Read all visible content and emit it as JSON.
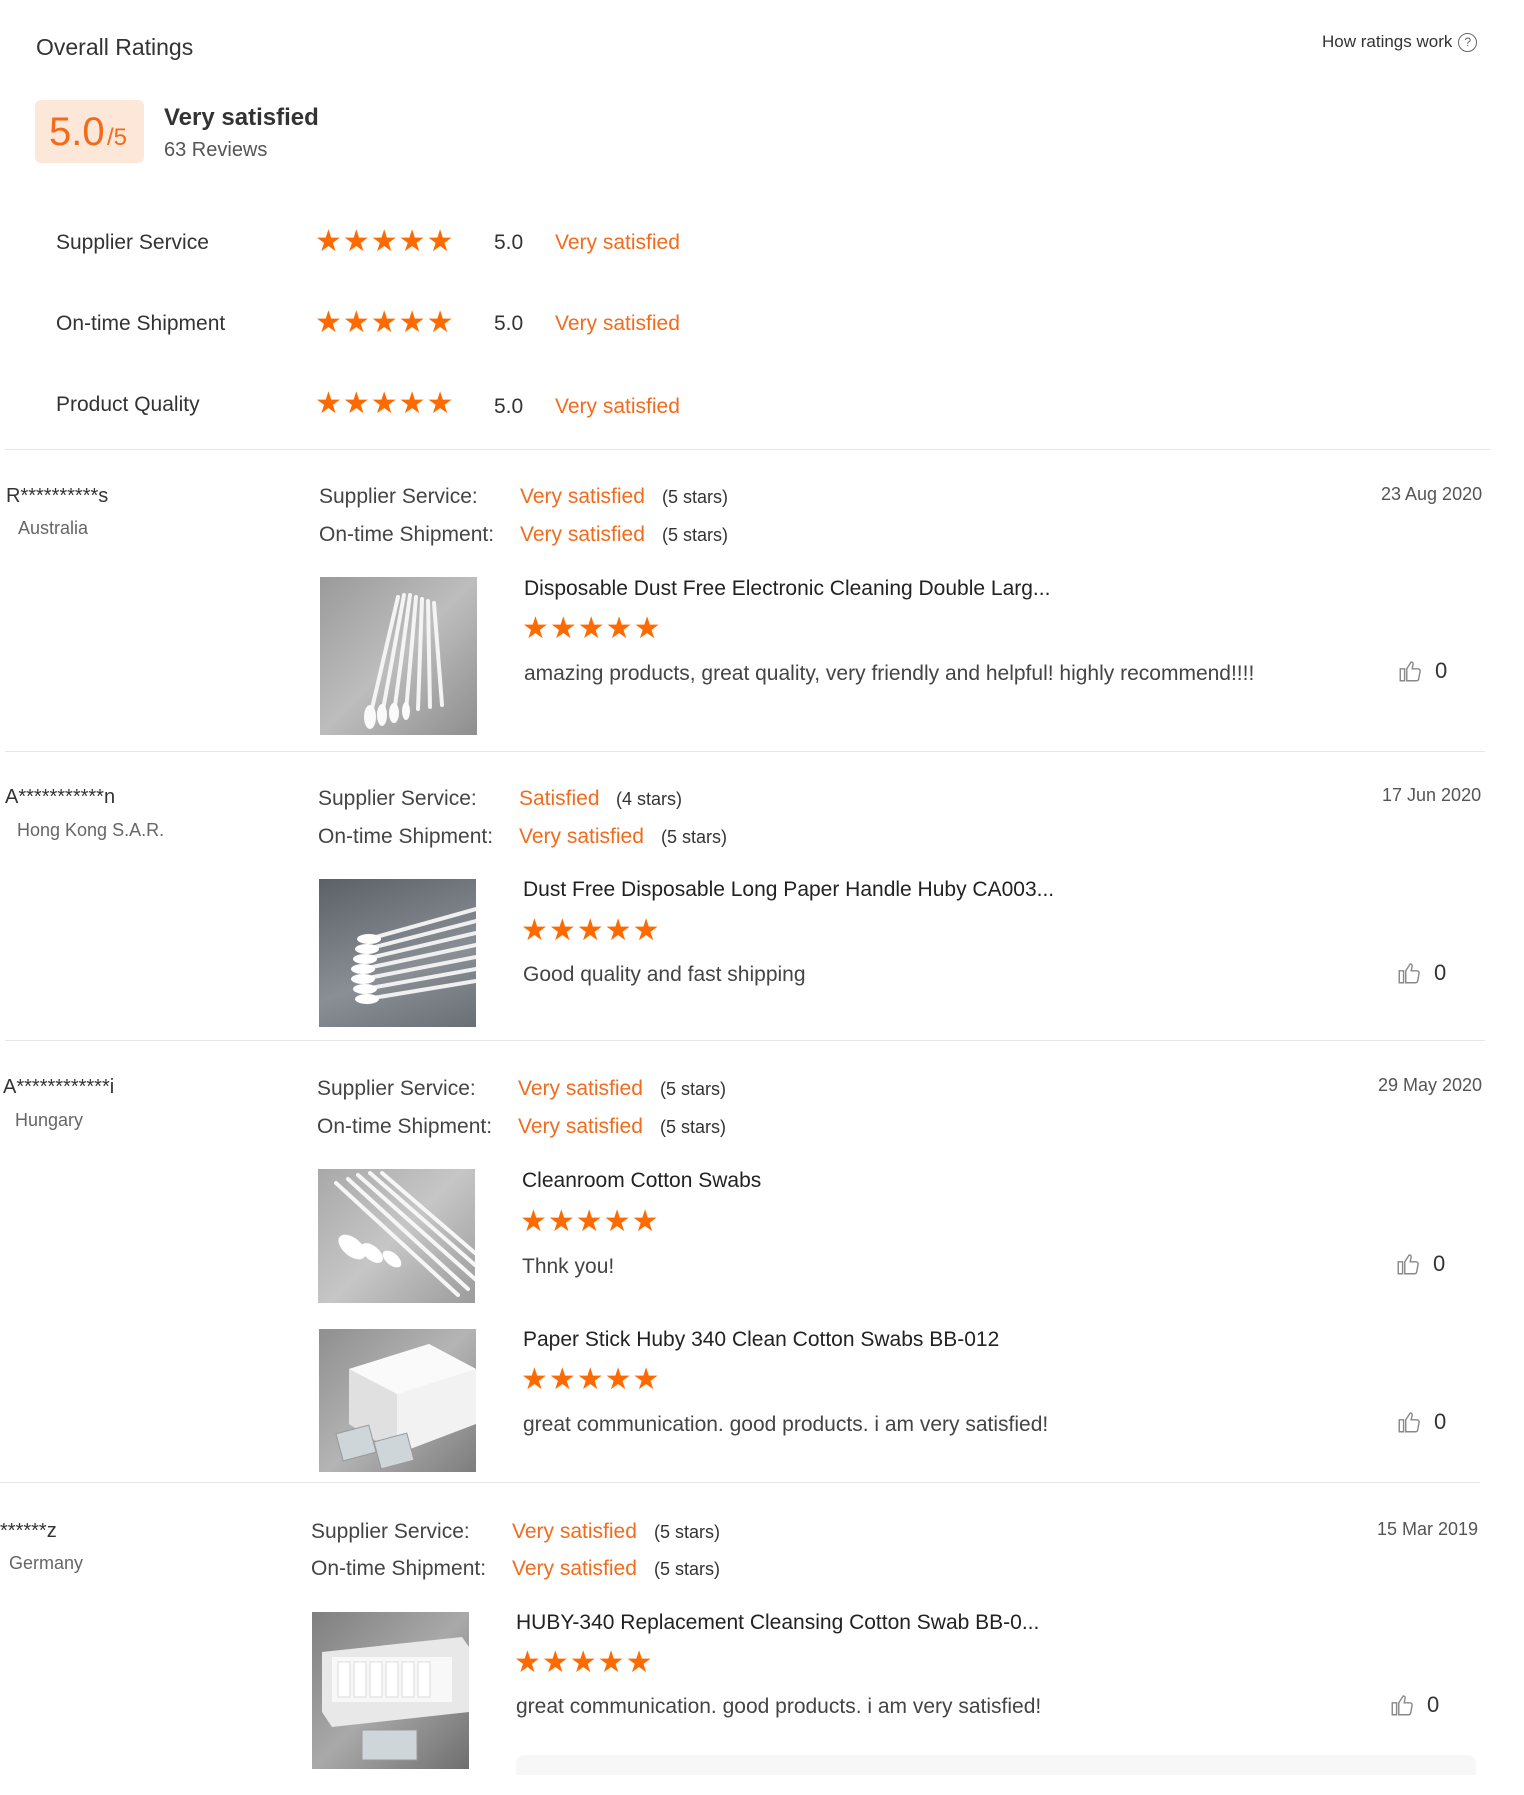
{
  "overall": {
    "title": "Overall Ratings",
    "how_link": "How ratings work",
    "help_icon": "?",
    "score": "5.0",
    "score_max": "/5",
    "verdict": "Very satisfied",
    "reviews_count": "63 Reviews",
    "breakdown": [
      {
        "label": "Supplier Service",
        "stars": 5,
        "value": "5.0",
        "verdict": "Very satisfied"
      },
      {
        "label": "On-time Shipment",
        "stars": 5,
        "value": "5.0",
        "verdict": "Very satisfied"
      },
      {
        "label": "Product Quality",
        "stars": 5,
        "value": "5.0",
        "verdict": "Very satisfied"
      }
    ]
  },
  "labels": {
    "supplier_service": "Supplier Service:",
    "on_time_shipment": "On-time Shipment:"
  },
  "reviews": [
    {
      "name": "R**********s",
      "country": "Australia",
      "date": "23 Aug 2020",
      "supplier_verdict": "Very satisfied",
      "supplier_stars": "(5 stars)",
      "shipment_verdict": "Very satisfied",
      "shipment_stars": "(5 stars)",
      "products": [
        {
          "title": "Disposable Dust Free Electronic Cleaning Double Larg...",
          "stars": 5,
          "comment": "amazing products, great quality, very friendly and helpful! highly recommend!!!!",
          "likes": "0"
        }
      ]
    },
    {
      "name": "A***********n",
      "country": "Hong Kong S.A.R.",
      "date": "17 Jun 2020",
      "supplier_verdict": "Satisfied",
      "supplier_stars": "(4 stars)",
      "shipment_verdict": "Very satisfied",
      "shipment_stars": "(5 stars)",
      "products": [
        {
          "title": "Dust Free Disposable Long Paper Handle Huby CA003...",
          "stars": 5,
          "comment": "Good quality and fast shipping",
          "likes": "0"
        }
      ]
    },
    {
      "name": "A************i",
      "country": "Hungary",
      "date": "29 May 2020",
      "supplier_verdict": "Very satisfied",
      "supplier_stars": "(5 stars)",
      "shipment_verdict": "Very satisfied",
      "shipment_stars": "(5 stars)",
      "products": [
        {
          "title": "Cleanroom Cotton Swabs",
          "stars": 5,
          "comment": "Thnk you!",
          "likes": "0"
        },
        {
          "title": "Paper Stick Huby 340 Clean Cotton Swabs BB-012",
          "stars": 5,
          "comment": "great communication. good products. i am very satisfied!",
          "likes": "0"
        }
      ]
    },
    {
      "name": "******z",
      "country": "Germany",
      "date": "15 Mar 2019",
      "supplier_verdict": "Very satisfied",
      "supplier_stars": "(5 stars)",
      "shipment_verdict": "Very satisfied",
      "shipment_stars": "(5 stars)",
      "products": [
        {
          "title": "HUBY-340 Replacement Cleansing Cotton Swab BB-0...",
          "stars": 5,
          "comment": "great communication. good products. i am very satisfied!",
          "likes": "0"
        }
      ]
    }
  ],
  "colors": {
    "accent": "#ff6a00",
    "score_bg": "#fde7d9",
    "divider": "#e6e6e6"
  }
}
